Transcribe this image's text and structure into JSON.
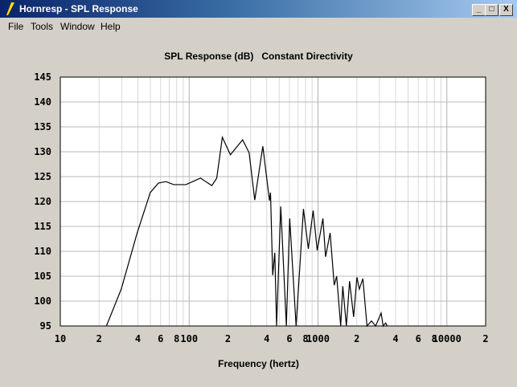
{
  "window": {
    "title": "Hornresp - SPL Response",
    "minimize": "_",
    "maximize": "□",
    "close": "X"
  },
  "menu": [
    "File",
    "Tools",
    "Window",
    "Help"
  ],
  "chart_data": {
    "type": "line",
    "title": "SPL Response (dB)   Constant Directivity",
    "xlabel": "Frequency (hertz)",
    "ylabel": "",
    "xscale": "log",
    "xlim": [
      10,
      20000
    ],
    "ylim": [
      95,
      145
    ],
    "grid": true,
    "y_ticks": [
      145,
      140,
      135,
      130,
      125,
      120,
      115,
      110,
      105,
      100,
      95
    ],
    "x_ticks": [
      {
        "value": 10,
        "label": "10"
      },
      {
        "value": 20,
        "label": "2"
      },
      {
        "value": 40,
        "label": "4"
      },
      {
        "value": 60,
        "label": "6"
      },
      {
        "value": 80,
        "label": "8"
      },
      {
        "value": 100,
        "label": "100"
      },
      {
        "value": 200,
        "label": "2"
      },
      {
        "value": 400,
        "label": "4"
      },
      {
        "value": 600,
        "label": "6"
      },
      {
        "value": 800,
        "label": "8"
      },
      {
        "value": 1000,
        "label": "1000"
      },
      {
        "value": 2000,
        "label": "2"
      },
      {
        "value": 4000,
        "label": "4"
      },
      {
        "value": 6000,
        "label": "6"
      },
      {
        "value": 8000,
        "label": "8"
      },
      {
        "value": 10000,
        "label": "10000"
      },
      {
        "value": 20000,
        "label": "2"
      }
    ],
    "series": [
      {
        "name": "SPL",
        "x": [
          22.8,
          29.7,
          39.5,
          49.9,
          57.7,
          66,
          75.9,
          94.4,
          122.5,
          150,
          163.7,
          181,
          209,
          260,
          292,
          323,
          373,
          420,
          428,
          445,
          462,
          477,
          514,
          568,
          603,
          676,
          771,
          841,
          917,
          986,
          1092,
          1145,
          1242,
          1336,
          1396,
          1500,
          1557,
          1660,
          1758,
          1890,
          2004,
          2093,
          2230,
          2400,
          2600,
          2800,
          3090,
          3200,
          3350,
          3450
        ],
        "y": [
          95,
          102.4,
          113.7,
          121.8,
          123.7,
          124,
          123.4,
          123.4,
          124.7,
          123.2,
          124.7,
          132.9,
          129.4,
          132.4,
          129.8,
          120.3,
          131.1,
          120.2,
          121.8,
          105.2,
          109.7,
          95,
          119,
          95,
          116.6,
          95,
          118.5,
          110.5,
          118.2,
          110.2,
          116.6,
          108.9,
          113.7,
          103.2,
          105,
          95,
          103,
          95,
          104,
          96.8,
          104.8,
          102.4,
          104.5,
          95,
          96,
          95,
          97.6,
          95,
          95.6,
          95
        ]
      }
    ]
  }
}
